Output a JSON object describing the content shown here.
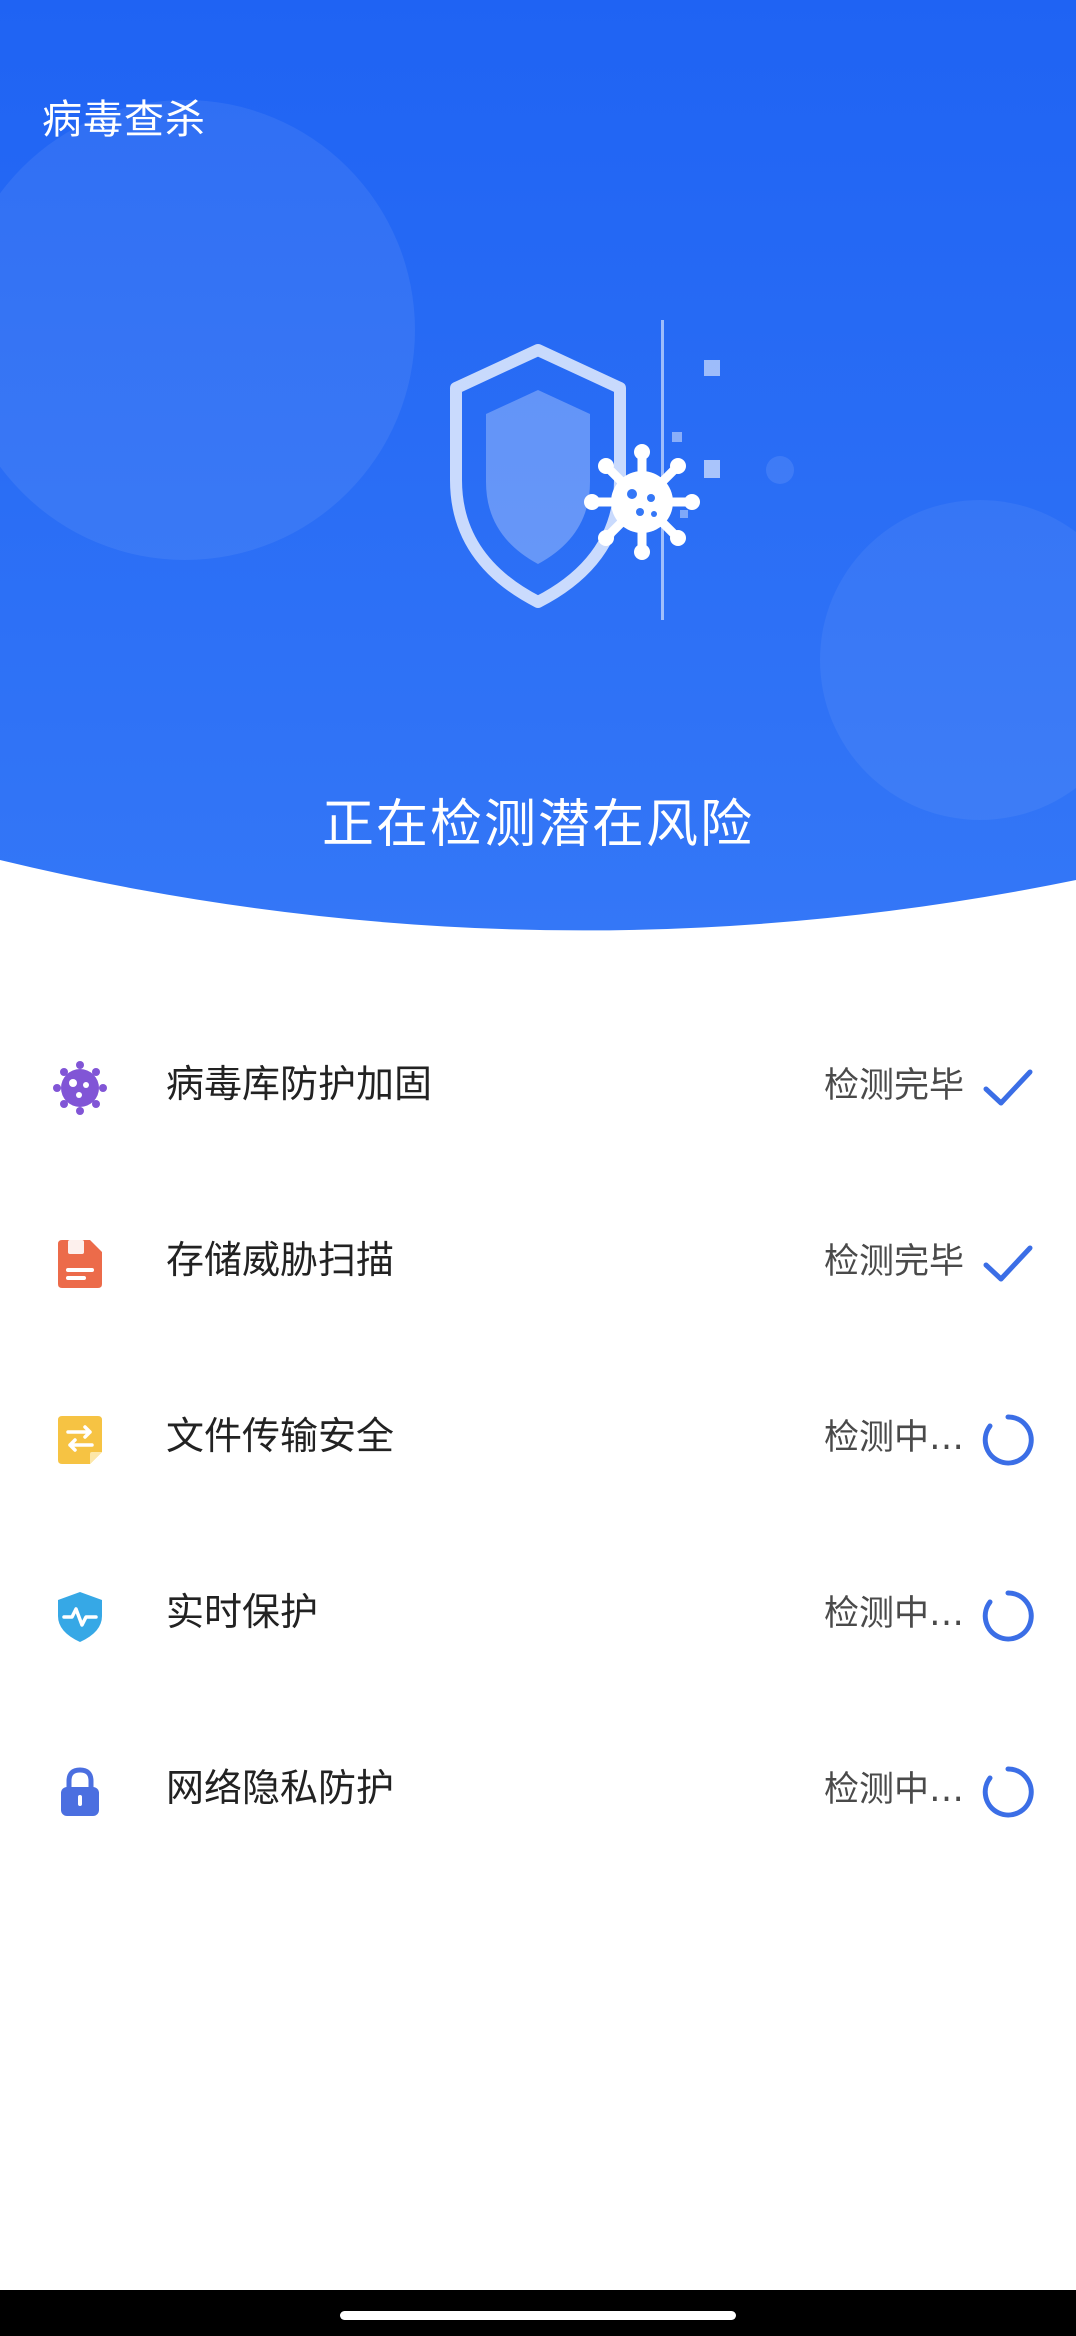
{
  "header": {
    "title": "病毒查杀"
  },
  "hero": {
    "status_text": "正在检测潜在风险"
  },
  "colors": {
    "hero_blue": "#2f6ff5",
    "hero_blue_top": "#1f63f3",
    "accent_check": "#3b6ee6",
    "virus_purple": "#8155d6",
    "storage_orange": "#ec6b4a",
    "transfer_yellow": "#f6c343",
    "shield_cyan": "#36a8e6",
    "lock_blue": "#4b6fe0"
  },
  "scan_items": [
    {
      "icon": "virus-icon",
      "label": "病毒库防护加固",
      "status": "检测完毕",
      "indicator": "check-icon"
    },
    {
      "icon": "storage-icon",
      "label": "存储威胁扫描",
      "status": "检测完毕",
      "indicator": "check-icon"
    },
    {
      "icon": "file-transfer-icon",
      "label": "文件传输安全",
      "status": "检测中…",
      "indicator": "spinner-icon"
    },
    {
      "icon": "shield-pulse-icon",
      "label": "实时保护",
      "status": "检测中…",
      "indicator": "spinner-icon"
    },
    {
      "icon": "lock-icon",
      "label": "网络隐私防护",
      "status": "检测中…",
      "indicator": "spinner-icon"
    }
  ]
}
